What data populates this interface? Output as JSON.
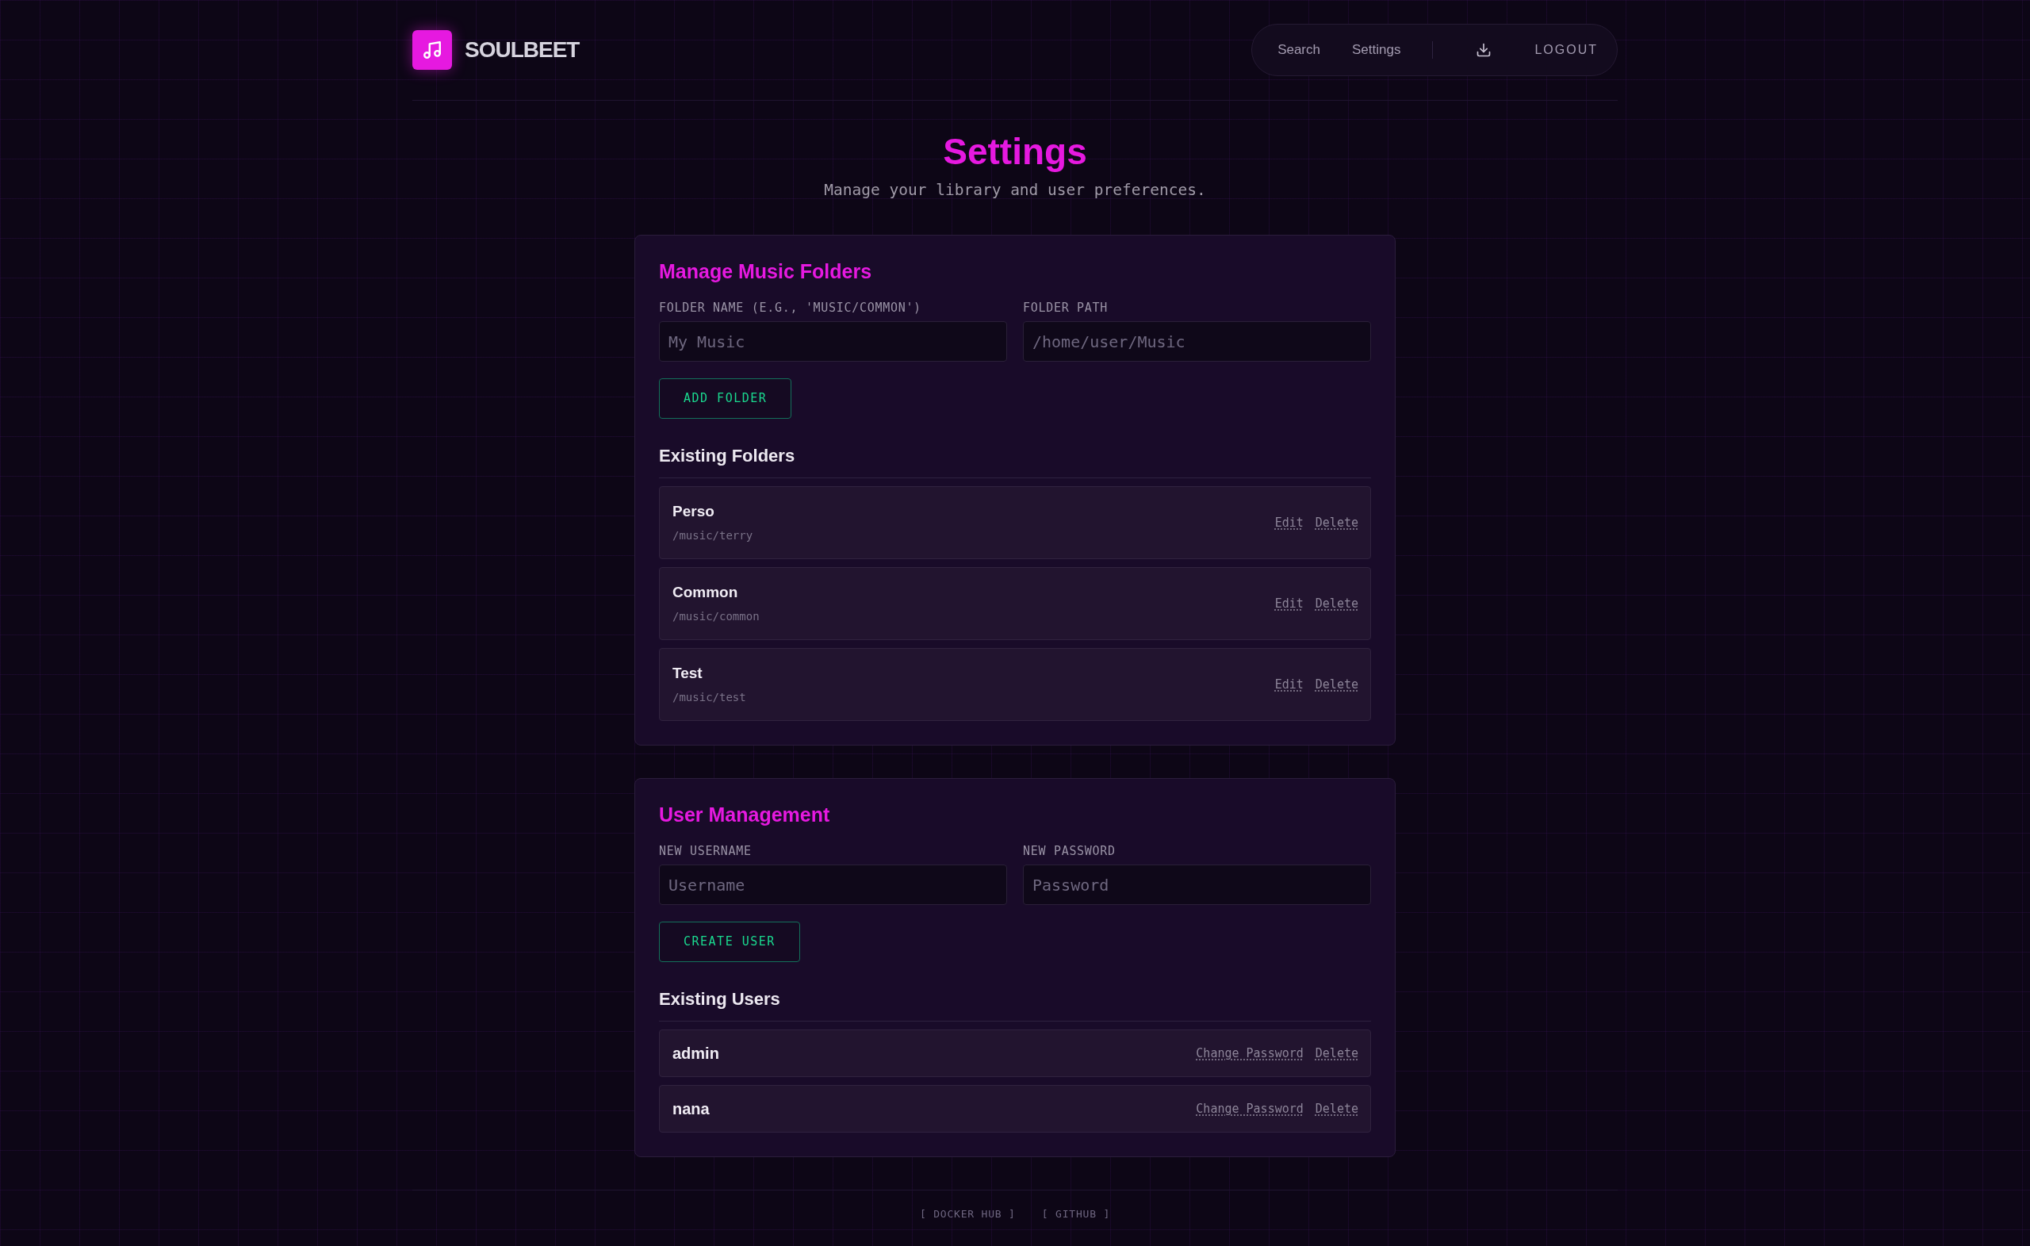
{
  "header": {
    "logo_text": "SOULBEET",
    "nav": [
      {
        "label": "Search"
      },
      {
        "label": "Settings"
      }
    ],
    "logout": "LOGOUT"
  },
  "page": {
    "title": "Settings",
    "subtitle": "Manage your library and user preferences."
  },
  "folders_section": {
    "title": "Manage Music Folders",
    "fields": [
      {
        "label": "FOLDER NAME (E.G., 'MUSIC/COMMON')",
        "placeholder": "My Music"
      },
      {
        "label": "FOLDER PATH",
        "placeholder": "/home/user/Music"
      }
    ],
    "button": "ADD FOLDER",
    "list_title": "Existing Folders",
    "items": [
      {
        "name": "Perso",
        "path": "/music/terry",
        "actions": [
          "Edit",
          "Delete"
        ]
      },
      {
        "name": "Common",
        "path": "/music/common",
        "actions": [
          "Edit",
          "Delete"
        ]
      },
      {
        "name": "Test",
        "path": "/music/test",
        "actions": [
          "Edit",
          "Delete"
        ]
      }
    ]
  },
  "users_section": {
    "title": "User Management",
    "fields": [
      {
        "label": "NEW USERNAME",
        "placeholder": "Username"
      },
      {
        "label": "NEW PASSWORD",
        "placeholder": "Password"
      }
    ],
    "button": "CREATE USER",
    "list_title": "Existing Users",
    "items": [
      {
        "name": "admin",
        "actions": [
          "Change Password",
          "Delete"
        ]
      },
      {
        "name": "nana",
        "actions": [
          "Change Password",
          "Delete"
        ]
      }
    ]
  },
  "footer": {
    "links": [
      "[ DOCKER HUB ]",
      "[ GITHUB ]"
    ]
  }
}
